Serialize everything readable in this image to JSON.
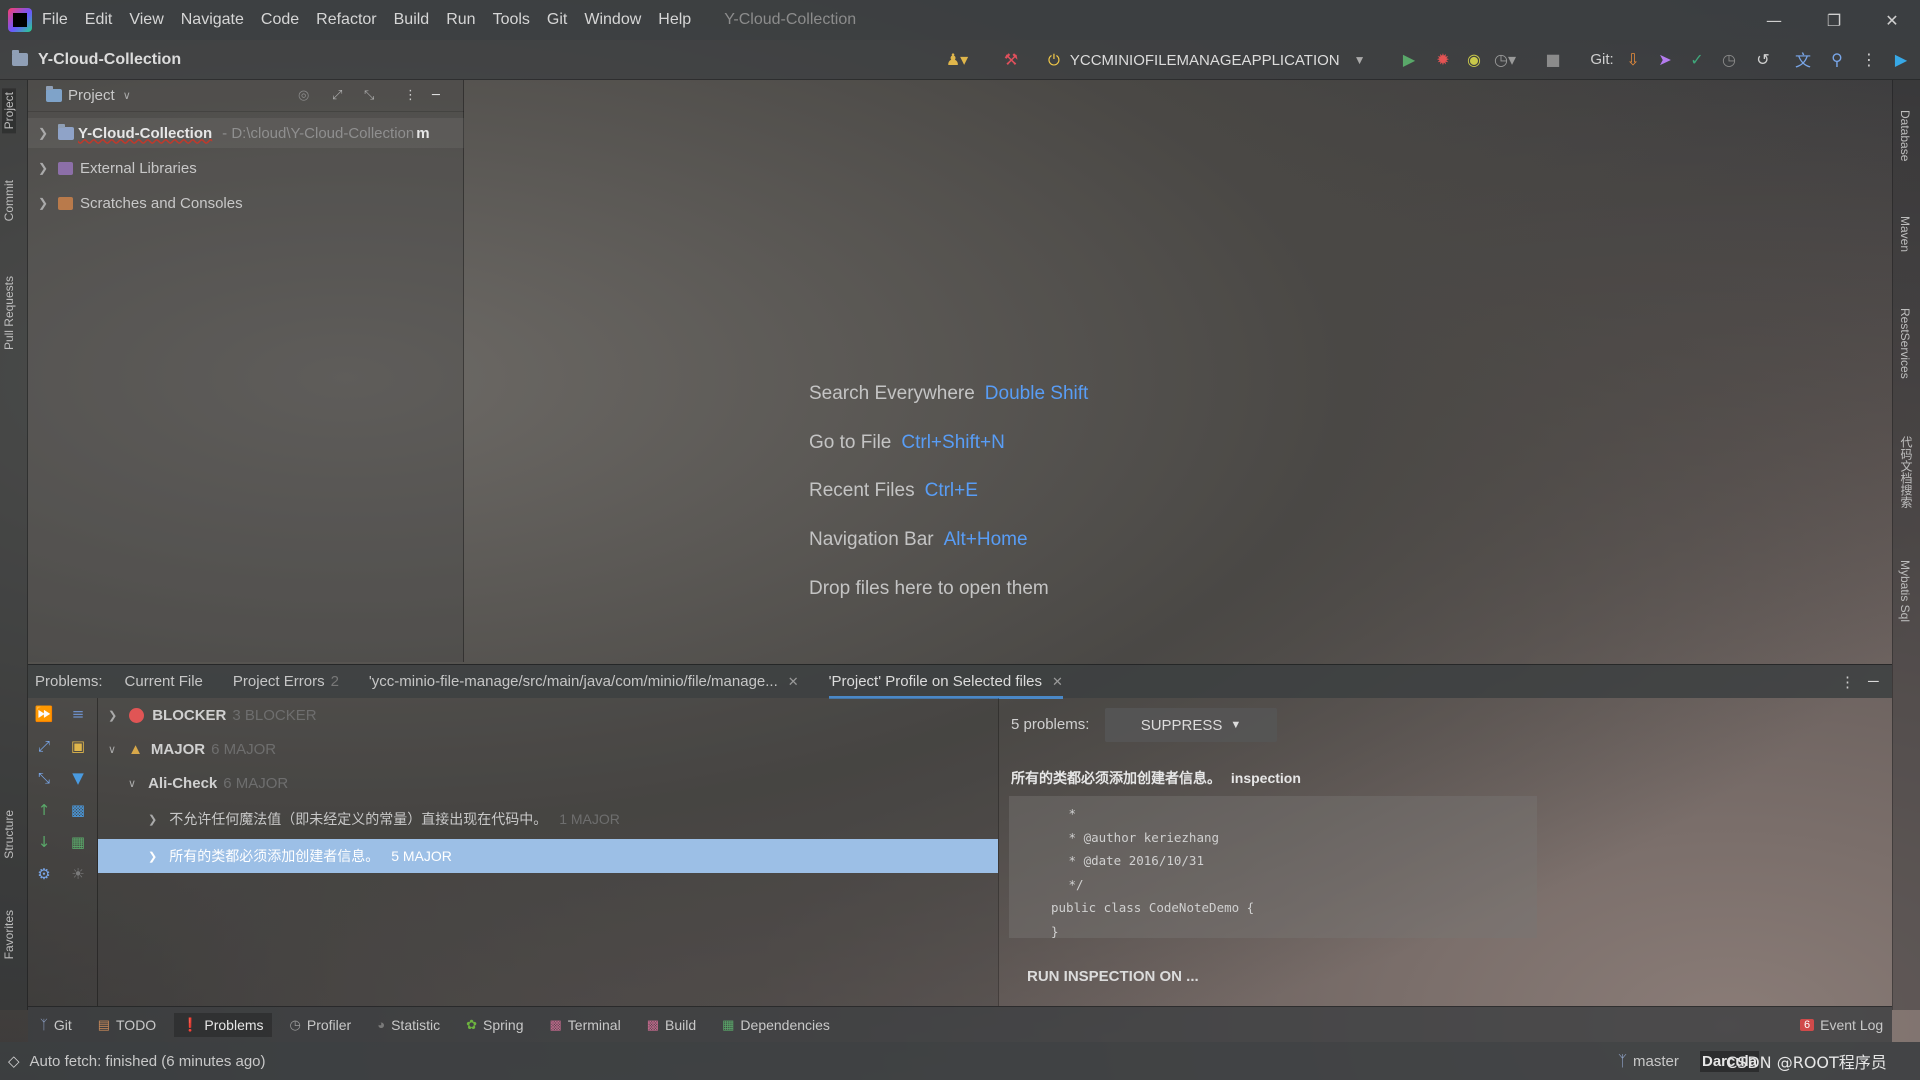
{
  "menubar": {
    "items": [
      "File",
      "Edit",
      "View",
      "Navigate",
      "Code",
      "Refactor",
      "Build",
      "Run",
      "Tools",
      "Git",
      "Window",
      "Help"
    ],
    "title": "Y-Cloud-Collection"
  },
  "toolbar": {
    "project_name": "Y-Cloud-Collection",
    "run_config": "YCCMINIOFILEMANAGEAPPLICATION",
    "git_label": "Git:"
  },
  "left_stripe": {
    "tabs": [
      "Project",
      "Commit",
      "Pull Requests",
      "Structure",
      "Favorites"
    ]
  },
  "right_stripe": {
    "tabs": [
      "Database",
      "Maven",
      "RestServices",
      "代码文档搜索",
      "Mybatis Sql"
    ]
  },
  "project_panel": {
    "view_label": "Project",
    "tree": [
      {
        "label": "Y-Cloud-Collection",
        "path": "- D:\\cloud\\Y-Cloud-Collection",
        "suffix": "m"
      },
      {
        "label": "External Libraries"
      },
      {
        "label": "Scratches and Consoles"
      }
    ]
  },
  "editor_hints": [
    {
      "text": "Search Everywhere",
      "key": "Double Shift"
    },
    {
      "text": "Go to File",
      "key": "Ctrl+Shift+N"
    },
    {
      "text": "Recent Files",
      "key": "Ctrl+E"
    },
    {
      "text": "Navigation Bar",
      "key": "Alt+Home"
    },
    {
      "text": "Drop files here to open them",
      "key": ""
    }
  ],
  "problems": {
    "label": "Problems:",
    "tabs": [
      {
        "label": "Current File",
        "count": ""
      },
      {
        "label": "Project Errors",
        "count": "2"
      },
      {
        "label": "'ycc-minio-file-manage/src/main/java/com/minio/file/manage...",
        "count": "",
        "closable": true
      },
      {
        "label": "'Project' Profile on Selected files",
        "count": "",
        "closable": true
      }
    ],
    "tree": [
      {
        "label": "BLOCKER",
        "count": "3 BLOCKER"
      },
      {
        "label": "MAJOR",
        "count": "6 MAJOR"
      },
      {
        "label": "Ali-Check",
        "count": "6 MAJOR"
      },
      {
        "label": "不允许任何魔法值（即未经定义的常量）直接出现在代码中。",
        "count": "1 MAJOR"
      },
      {
        "label": "所有的类都必须添加创建者信息。",
        "count": "5 MAJOR"
      }
    ],
    "detail": {
      "count_label": "5 problems:",
      "suppress": "SUPPRESS",
      "heading": "所有的类都必须添加创建者信息。",
      "heading_tag": "inspection",
      "code": [
        " *",
        " * @author keriezhang",
        " * @date 2016/10/31",
        " */",
        "public class CodeNoteDemo {",
        "}"
      ],
      "run_inspection": "RUN INSPECTION ON ..."
    }
  },
  "bottom_tools": [
    {
      "label": "Git",
      "icon": "branch-icon"
    },
    {
      "label": "TODO",
      "icon": "todo-icon"
    },
    {
      "label": "Problems",
      "icon": "problems-icon"
    },
    {
      "label": "Profiler",
      "icon": "profiler-icon"
    },
    {
      "label": "Statistic",
      "icon": "statistic-icon"
    },
    {
      "label": "Spring",
      "icon": "spring-icon"
    },
    {
      "label": "Terminal",
      "icon": "terminal-icon"
    },
    {
      "label": "Build",
      "icon": "build-icon"
    },
    {
      "label": "Dependencies",
      "icon": "dependencies-icon"
    }
  ],
  "event_log": {
    "count": "6",
    "label": "Event Log"
  },
  "statusbar": {
    "message": "Auto fetch: finished (6 minutes ago)",
    "branch": "master",
    "theme": "Darcula",
    "watermark": "CSDN @ROOT程序员"
  },
  "colors": {
    "accent_key": "#589df6",
    "selection": "#9cbfe6"
  }
}
